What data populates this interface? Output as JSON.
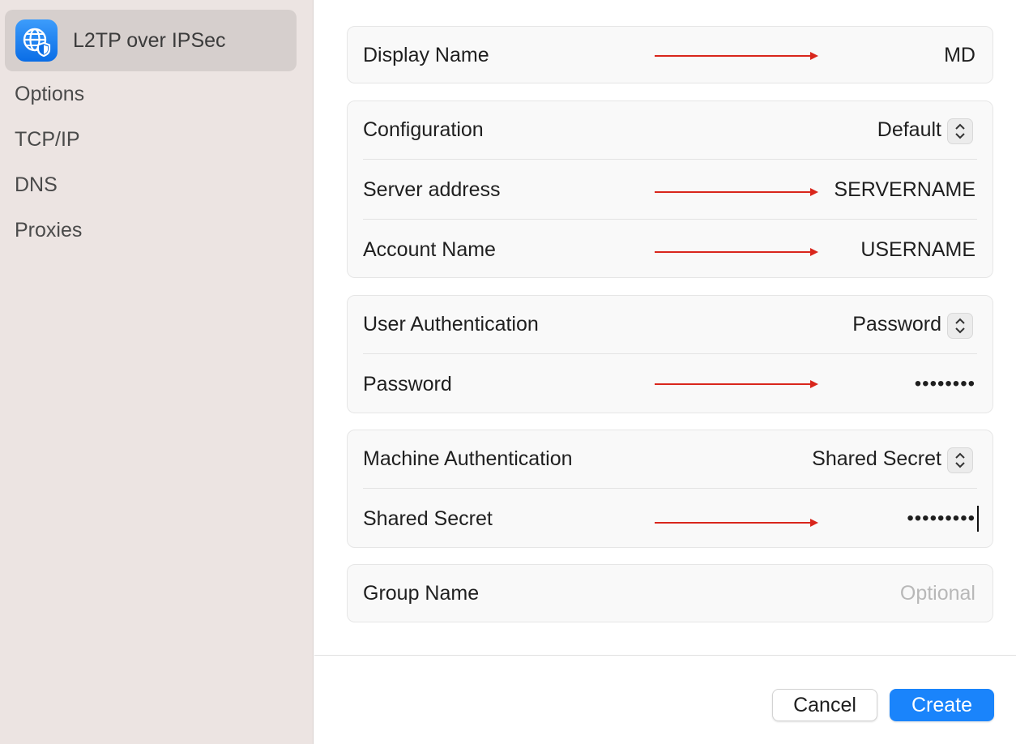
{
  "sidebar": {
    "selected": {
      "label": "L2TP over IPSec",
      "icon": "vpn-globe-shield-icon"
    },
    "items": [
      {
        "label": "Options"
      },
      {
        "label": "TCP/IP"
      },
      {
        "label": "DNS"
      },
      {
        "label": "Proxies"
      }
    ]
  },
  "form": {
    "display_name": {
      "label": "Display Name",
      "value": "MD"
    },
    "configuration": {
      "label": "Configuration",
      "value": "Default"
    },
    "server_address": {
      "label": "Server address",
      "value": "SERVERNAME"
    },
    "account_name": {
      "label": "Account Name",
      "value": "USERNAME"
    },
    "user_authentication": {
      "label": "User Authentication",
      "value": "Password"
    },
    "password": {
      "label": "Password",
      "value": "••••••••"
    },
    "machine_authentication": {
      "label": "Machine Authentication",
      "value": "Shared Secret"
    },
    "shared_secret": {
      "label": "Shared Secret",
      "value": "•••••••••"
    },
    "group_name": {
      "label": "Group Name",
      "placeholder": "Optional"
    }
  },
  "buttons": {
    "cancel": "Cancel",
    "create": "Create"
  },
  "colors": {
    "accent": "#1a84fb",
    "annotation_arrow": "#d9261c",
    "sidebar_bg": "#ece4e2"
  }
}
